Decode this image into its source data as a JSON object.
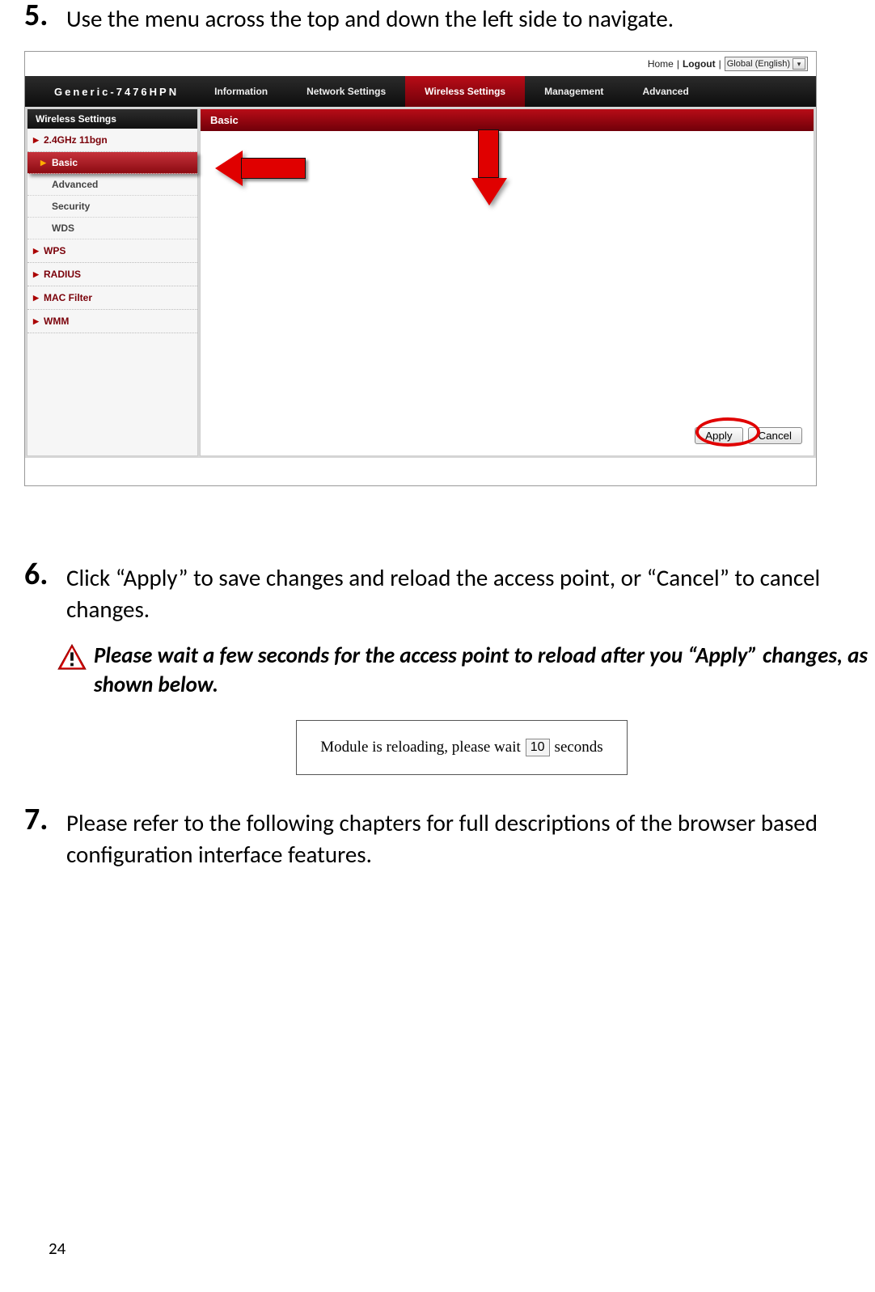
{
  "steps": {
    "s5_num": "5.",
    "s5_text": "Use the menu across the top and down the left side to navigate.",
    "s6_num": "6.",
    "s6_text": "Click “Apply” to save changes and reload the access point, or “Cancel” to cancel changes.",
    "s7_num": "7.",
    "s7_text": "Please refer to the following chapters for full descriptions of the browser based configuration interface features."
  },
  "topbar": {
    "home": "Home",
    "sep": "|",
    "logout": "Logout",
    "lang": "Global (English)"
  },
  "mainmenu": {
    "brand": "Generic-7476HPN",
    "items": [
      "Information",
      "Network Settings",
      "Wireless Settings",
      "Management",
      "Advanced"
    ],
    "active_index": 2
  },
  "sidebar": {
    "header": "Wireless Settings",
    "group0": "2.4GHz 11bgn",
    "subs": [
      "Basic",
      "Advanced",
      "Security",
      "WDS"
    ],
    "active_sub_index": 0,
    "groups_rest": [
      "WPS",
      "RADIUS",
      "MAC Filter",
      "WMM"
    ]
  },
  "content": {
    "header": "Basic",
    "apply": "Apply",
    "cancel": "Cancel"
  },
  "warning_text": "Please wait a few seconds for the access point to reload after you “Apply” changes, as shown below.",
  "reload": {
    "before": "Module is reloading, please wait",
    "count": "10",
    "after": "seconds"
  },
  "page_number": "24"
}
